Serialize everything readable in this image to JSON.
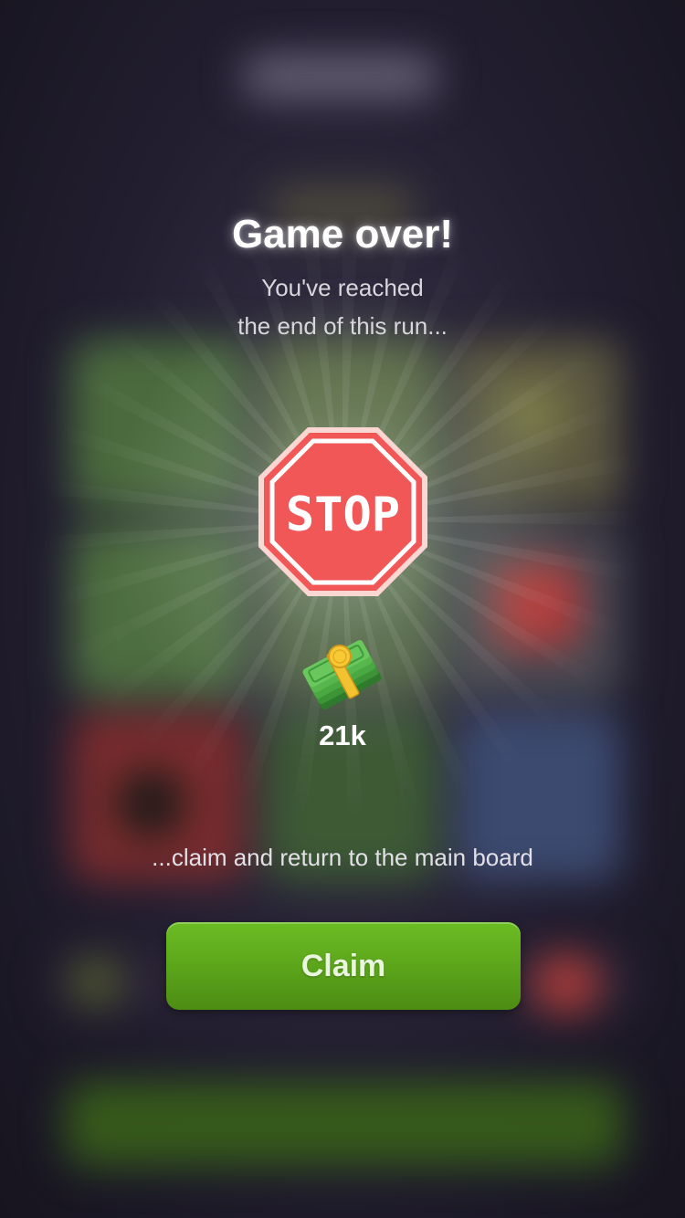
{
  "dialog": {
    "title": "Game over!",
    "subtitle_line1": "You've reached",
    "subtitle_line2": "the end of this run...",
    "sign_text": "STOP",
    "reward_amount": "21k",
    "instruction": "...claim and return to the main board",
    "claim_label": "Claim"
  },
  "icons": {
    "sign": "stop-sign-icon",
    "reward": "money-stack-icon"
  },
  "colors": {
    "stop_red": "#f25757",
    "claim_green": "#5aa31a",
    "background": "#1c1828"
  }
}
